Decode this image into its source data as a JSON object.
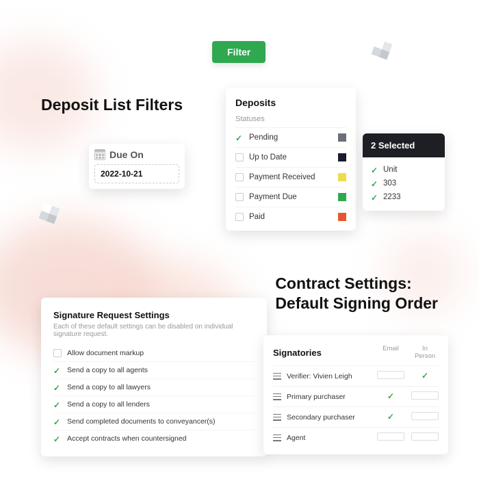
{
  "headings": {
    "filters": "Deposit List Filters",
    "contract_line1": "Contract Settings:",
    "contract_line2": "Default Signing Order"
  },
  "filter_button": {
    "label": "Filter"
  },
  "due_on": {
    "label": "Due On",
    "value": "2022-10-21"
  },
  "deposits": {
    "title": "Deposits",
    "subhead": "Statuses",
    "statuses": [
      {
        "label": "Pending",
        "checked": true,
        "color": "#6a6f7a"
      },
      {
        "label": "Up to Date",
        "checked": false,
        "color": "#1a1c2b"
      },
      {
        "label": "Payment Received",
        "checked": false,
        "color": "#eedd4a"
      },
      {
        "label": "Payment Due",
        "checked": false,
        "color": "#2fa84f"
      },
      {
        "label": "Paid",
        "checked": false,
        "color": "#e4572e"
      }
    ]
  },
  "selected": {
    "count_label": "2 Selected",
    "items": [
      "Unit",
      "303",
      "2233"
    ]
  },
  "signature_settings": {
    "title": "Signature Request Settings",
    "subtitle": "Each of these default settings can be disabled on individual signature request.",
    "items": [
      {
        "label": "Allow document markup",
        "checked": false
      },
      {
        "label": "Send a copy to all agents",
        "checked": true
      },
      {
        "label": "Send a copy to all lawyers",
        "checked": true
      },
      {
        "label": "Send a copy to all lenders",
        "checked": true
      },
      {
        "label": "Send completed documents to conveyancer(s)",
        "checked": true
      },
      {
        "label": "Accept contracts when countersigned",
        "checked": true
      }
    ]
  },
  "signatories": {
    "title": "Signatories",
    "col_email": "Email",
    "col_inperson": "In Person",
    "rows": [
      {
        "label": "Verifier: Vivien Leigh",
        "email": false,
        "in_person": true
      },
      {
        "label": "Primary purchaser",
        "email": true,
        "in_person": false
      },
      {
        "label": "Secondary purchaser",
        "email": true,
        "in_person": false
      },
      {
        "label": "Agent",
        "email": false,
        "in_person": false
      }
    ]
  }
}
